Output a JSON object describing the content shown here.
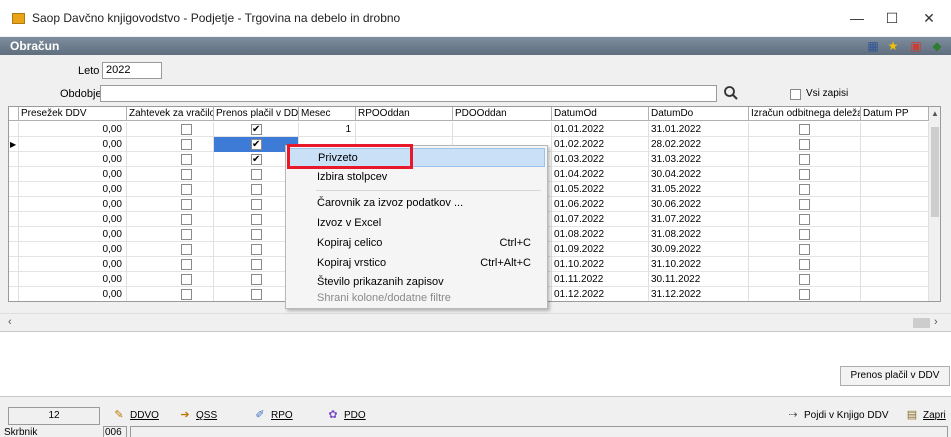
{
  "window": {
    "title": "Saop Davčno knjigovodstvo - Podjetje - Trgovina na debelo in drobno",
    "min_glyph": "—",
    "max_glyph": "☐",
    "close_glyph": "✕"
  },
  "panel": {
    "title": "Obračun",
    "icons": [
      "grid-icon",
      "star-icon",
      "pdf-icon",
      "book-icon"
    ]
  },
  "filters": {
    "leto_label": "Leto",
    "leto_value": "2022",
    "obdobje_label": "Obdobje",
    "obdobje_value": "",
    "vsi_zapisi_label": "Vsi zapisi"
  },
  "grid": {
    "columns": [
      "Presežek DDV",
      "Zahtevek za vračilo",
      "Prenos plačil v DDV",
      "Mesec",
      "RPOOddan",
      "PDOOddan",
      "DatumOd",
      "DatumDo",
      "Izračun odbitnega deleža",
      "Datum PP"
    ],
    "rows": [
      {
        "presezek": "0,00",
        "zahtevek": false,
        "prenos": true,
        "mesec": "1",
        "od": "01.01.2022",
        "do": "31.01.2022"
      },
      {
        "presezek": "0,00",
        "zahtevek": false,
        "prenos": true,
        "mesec": "",
        "od": "01.02.2022",
        "do": "28.02.2022"
      },
      {
        "presezek": "0,00",
        "zahtevek": false,
        "prenos": true,
        "mesec": "",
        "od": "01.03.2022",
        "do": "31.03.2022"
      },
      {
        "presezek": "0,00",
        "zahtevek": false,
        "prenos": false,
        "mesec": "",
        "od": "01.04.2022",
        "do": "30.04.2022"
      },
      {
        "presezek": "0,00",
        "zahtevek": false,
        "prenos": false,
        "mesec": "",
        "od": "01.05.2022",
        "do": "31.05.2022"
      },
      {
        "presezek": "0,00",
        "zahtevek": false,
        "prenos": false,
        "mesec": "",
        "od": "01.06.2022",
        "do": "30.06.2022"
      },
      {
        "presezek": "0,00",
        "zahtevek": false,
        "prenos": false,
        "mesec": "",
        "od": "01.07.2022",
        "do": "31.07.2022"
      },
      {
        "presezek": "0,00",
        "zahtevek": false,
        "prenos": false,
        "mesec": "",
        "od": "01.08.2022",
        "do": "31.08.2022"
      },
      {
        "presezek": "0,00",
        "zahtevek": false,
        "prenos": false,
        "mesec": "",
        "od": "01.09.2022",
        "do": "30.09.2022"
      },
      {
        "presezek": "0,00",
        "zahtevek": false,
        "prenos": false,
        "mesec": "",
        "od": "01.10.2022",
        "do": "31.10.2022"
      },
      {
        "presezek": "0,00",
        "zahtevek": false,
        "prenos": false,
        "mesec": "",
        "od": "01.11.2022",
        "do": "30.11.2022"
      },
      {
        "presezek": "0,00",
        "zahtevek": false,
        "prenos": false,
        "mesec": "",
        "od": "01.12.2022",
        "do": "31.12.2022"
      }
    ]
  },
  "context_menu": {
    "items": [
      {
        "label": "Privzeto",
        "shortcut": ""
      },
      {
        "label": "Izbira stolpcev",
        "shortcut": ""
      },
      {
        "label": "Čarovnik za izvoz podatkov ...",
        "shortcut": ""
      },
      {
        "label": "Izvoz v Excel",
        "shortcut": ""
      },
      {
        "label": "Kopiraj celico",
        "shortcut": "Ctrl+C"
      },
      {
        "label": "Kopiraj vrstico",
        "shortcut": "Ctrl+Alt+C"
      },
      {
        "label": "Število prikazanih zapisov",
        "shortcut": ""
      },
      {
        "label": "Shrani kolone/dodatne filtre",
        "shortcut": ""
      }
    ]
  },
  "buttons": {
    "prenos_placil": "Prenos plačil v DDV"
  },
  "footer": {
    "count": "12",
    "ddvo_label": "DDVO",
    "qss_label": "QSS",
    "rpo_label": "RPO",
    "pdo_label": "PDO",
    "pojdi_label": "Pojdi v Knjigo DDV",
    "zapri_label": "Zapri",
    "user_label": "Skrbnik",
    "code_label": "006"
  }
}
